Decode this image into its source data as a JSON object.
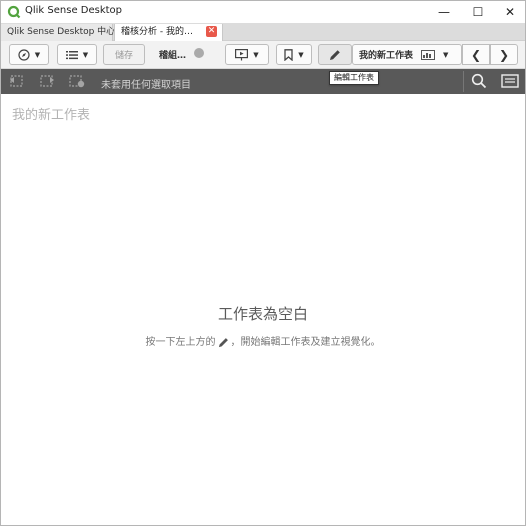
{
  "window": {
    "title": "Qlik Sense Desktop",
    "minimize": "—",
    "maximize": "☐",
    "close": "✕"
  },
  "tabs": [
    {
      "label": "Qlik Sense Desktop 中心"
    },
    {
      "label": "稽核分析 - 我的…"
    }
  ],
  "toolbar": {
    "save_label": "儲存",
    "app_name": "稽組…",
    "sheet_name": "我的新工作表"
  },
  "tooltip": "編輯工作表",
  "selection_bar": {
    "status": "未套用任何選取項目"
  },
  "sheet": {
    "title": "我的新工作表",
    "empty_title": "工作表為空白",
    "empty_desc_before": "按一下左上方的",
    "empty_desc_after": "，開始編輯工作表及建立視覺化。"
  },
  "colors": {
    "selection_bar_bg": "#595959",
    "tab_close": "#e8584a",
    "toolbar_bg": "#f2f2f2"
  }
}
